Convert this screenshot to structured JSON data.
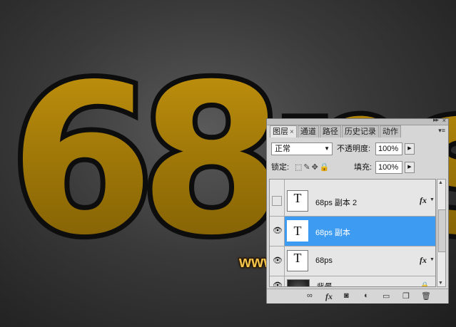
{
  "canvas": {
    "big_text": "68ps",
    "colors": {
      "gold": "#b8860b",
      "gold_light": "#d9a316",
      "outline": "#0d0d0d"
    }
  },
  "watermark": "www.68ps.com",
  "panel": {
    "tabs": [
      {
        "label": "图层",
        "active": true
      },
      {
        "label": "通道"
      },
      {
        "label": "路径"
      },
      {
        "label": "历史记录"
      },
      {
        "label": "动作"
      }
    ],
    "tab_close": "×",
    "blend_mode": "正常",
    "opacity_label": "不透明度:",
    "opacity_value": "100%",
    "lock_label": "锁定:",
    "fill_label": "填充:",
    "fill_value": "100%",
    "layers": [
      {
        "name": "68ps 副本 2",
        "thumb": "T",
        "visible": false,
        "fx": "fx"
      },
      {
        "name": "68ps 副本",
        "thumb": "T",
        "visible": true,
        "selected": true
      },
      {
        "name": "68ps",
        "thumb": "T",
        "visible": true,
        "fx": "fx"
      },
      {
        "name": "背景",
        "visible": true,
        "locked": true
      }
    ],
    "bottom_icons": [
      "link-icon",
      "fx-icon",
      "mask-icon",
      "adjustment-icon",
      "folder-icon",
      "new-layer-icon",
      "trash-icon"
    ],
    "bottom_fx": "fx",
    "accent": "#3d9bf2"
  }
}
